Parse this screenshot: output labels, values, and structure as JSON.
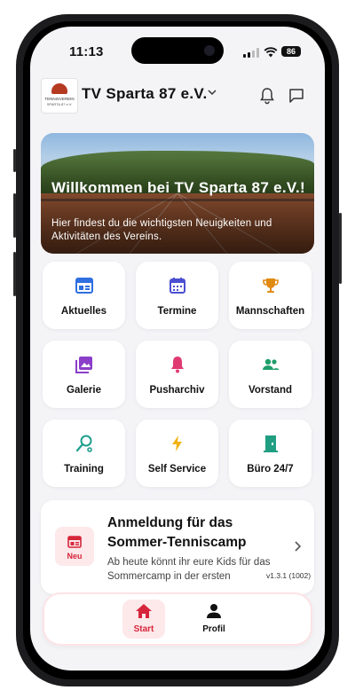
{
  "status_bar": {
    "time": "11:13",
    "battery": "86"
  },
  "app_bar": {
    "club_name": "TV Sparta 87 e.V.",
    "logo_line1": "TENNISVEREIN",
    "logo_line2": "SPARTA 87 e.V."
  },
  "hero": {
    "title": "Willkommen bei TV Sparta 87 e.V.!",
    "subtitle": "Hier findest du die wichtigsten Neuigkeiten und Aktivitäten des Vereins."
  },
  "tiles": [
    {
      "label": "Aktuelles",
      "icon": "news-icon",
      "color": "#2f6fe0"
    },
    {
      "label": "Termine",
      "icon": "calendar-icon",
      "color": "#4b4fd1"
    },
    {
      "label": "Mannschaften",
      "icon": "trophy-icon",
      "color": "#e08a12"
    },
    {
      "label": "Galerie",
      "icon": "gallery-icon",
      "color": "#8b3ec9"
    },
    {
      "label": "Pusharchiv",
      "icon": "bell-icon",
      "color": "#e03a73"
    },
    {
      "label": "Vorstand",
      "icon": "group-icon",
      "color": "#1f9e6a"
    },
    {
      "label": "Training",
      "icon": "racket-icon",
      "color": "#1f9e8e"
    },
    {
      "label": "Self Service",
      "icon": "lightning-icon",
      "color": "#f0b414"
    },
    {
      "label": "Büro 24/7",
      "icon": "door-icon",
      "color": "#1f9e82"
    }
  ],
  "news": {
    "badge": "Neu",
    "title": "Anmeldung für das Sommer-Tenniscamp",
    "description": "Ab heute könnt ihr eure Kids für das Sommercamp in der ersten"
  },
  "version": "v1.3.1 (1002)",
  "tabs": [
    {
      "label": "Start",
      "active": true
    },
    {
      "label": "Profil",
      "active": false
    }
  ],
  "colors": {
    "accent": "#d6253a",
    "accent_bg": "#fde8ea",
    "background": "#f4f4f7"
  }
}
